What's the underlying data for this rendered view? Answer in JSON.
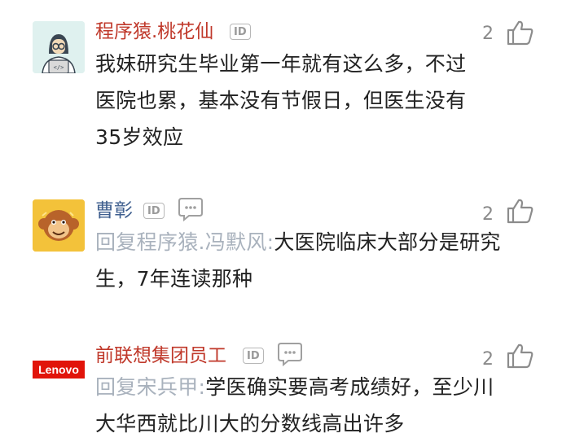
{
  "comments": [
    {
      "username": "程序猿.桃花仙",
      "id_badge": "ID",
      "likes": "2",
      "text": "我妹研究生毕业第一年就有这么多，不过医院也累，基本没有节假日，但医生没有35岁效应",
      "avatar": "programmer-avatar"
    },
    {
      "username": "曹彰",
      "id_badge": "ID",
      "likes": "2",
      "reply_prefix": "回复程序猿.冯默风:",
      "text": "大医院临床大部分是研究生，7年连读那种",
      "avatar": "monkey-avatar"
    },
    {
      "username": "前联想集团员工",
      "id_badge": "ID",
      "likes": "2",
      "reply_prefix": "回复宋兵甲:",
      "text": "学医确实要高考成绩好，至少川大华西就比川大的分数线高出许多",
      "avatar": "lenovo-logo",
      "avatar_text": "Lenovo"
    }
  ],
  "colors": {
    "username_red": "#c0392b",
    "username_blue": "#3f5f8f",
    "reply_gray": "#a9b2bd",
    "lenovo_red": "#e1140a"
  }
}
